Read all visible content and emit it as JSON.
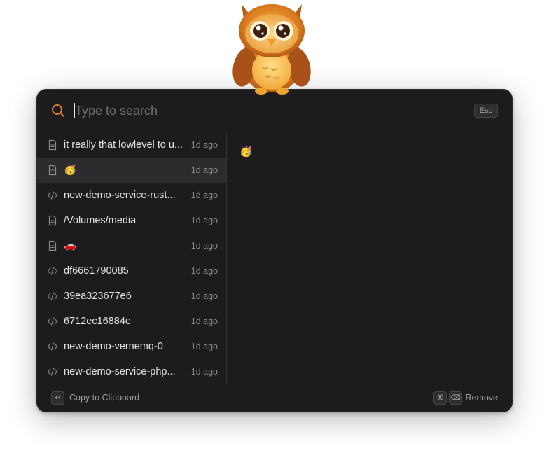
{
  "search": {
    "placeholder": "Type to search",
    "value": "",
    "esc_label": "Esc"
  },
  "items": [
    {
      "icon": "text-file-icon",
      "label": "it really that lowlevel to u...",
      "time": "1d ago"
    },
    {
      "icon": "text-file-icon",
      "label": "🥳",
      "time": "1d ago",
      "selected": true
    },
    {
      "icon": "code-icon",
      "label": "new-demo-service-rust...",
      "time": "1d ago"
    },
    {
      "icon": "text-file-icon",
      "label": "/Volumes/media",
      "time": "1d ago"
    },
    {
      "icon": "text-file-icon",
      "label": "🚗",
      "time": "1d ago"
    },
    {
      "icon": "code-icon",
      "label": "df6661790085",
      "time": "1d ago"
    },
    {
      "icon": "code-icon",
      "label": "39ea323677e6",
      "time": "1d ago"
    },
    {
      "icon": "code-icon",
      "label": "6712ec16884e",
      "time": "1d ago"
    },
    {
      "icon": "code-icon",
      "label": "new-demo-vernemq-0",
      "time": "1d ago"
    },
    {
      "icon": "code-icon",
      "label": "new-demo-service-php...",
      "time": "1d ago"
    }
  ],
  "detail": {
    "content": "🥳"
  },
  "footer": {
    "copy_key": "↵",
    "copy_label": "Copy to Clipboard",
    "remove_key_1": "⌘",
    "remove_key_2": "⌫",
    "remove_label": "Remove"
  },
  "colors": {
    "accent": "#e07a2e",
    "window_bg": "#1c1c1e",
    "selected_row": "#2c2c2f"
  }
}
